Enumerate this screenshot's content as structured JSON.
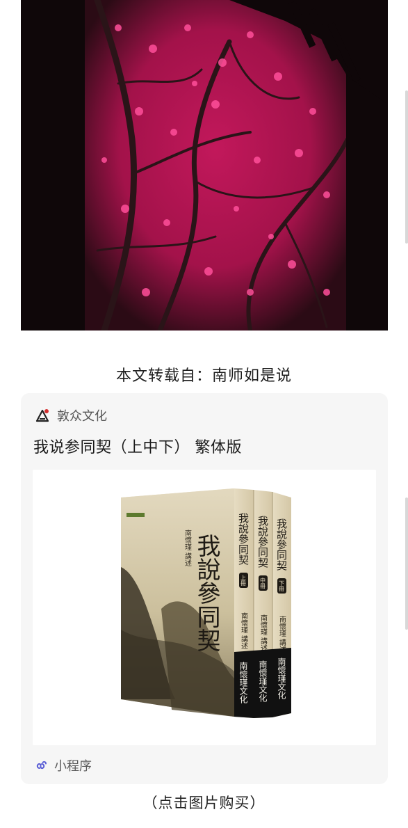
{
  "article": {
    "source_line": "本文转载自：南师如是说",
    "buy_hint": "（点击图片购买）"
  },
  "mini_program_card": {
    "brand_name": "敦众文化",
    "product_title": "我说参同契（上中下） 繁体版",
    "footer_label": "小程序",
    "accent_color": "#5b5fd6"
  },
  "book_box": {
    "title_calligraphy": "我說參同契",
    "front_author": "南懷瑾 講述",
    "spine_titles": [
      "我說參同契",
      "我說參同契",
      "我說參同契"
    ],
    "spine_volumes": [
      "上冊",
      "中冊",
      "下冊"
    ],
    "spine_author": "南懷瑾 講述",
    "spine_publisher": "南懷瑾文化"
  },
  "icons": {
    "brand_logo": "brand-logo-icon",
    "mini_program": "mini-program-link-icon"
  }
}
